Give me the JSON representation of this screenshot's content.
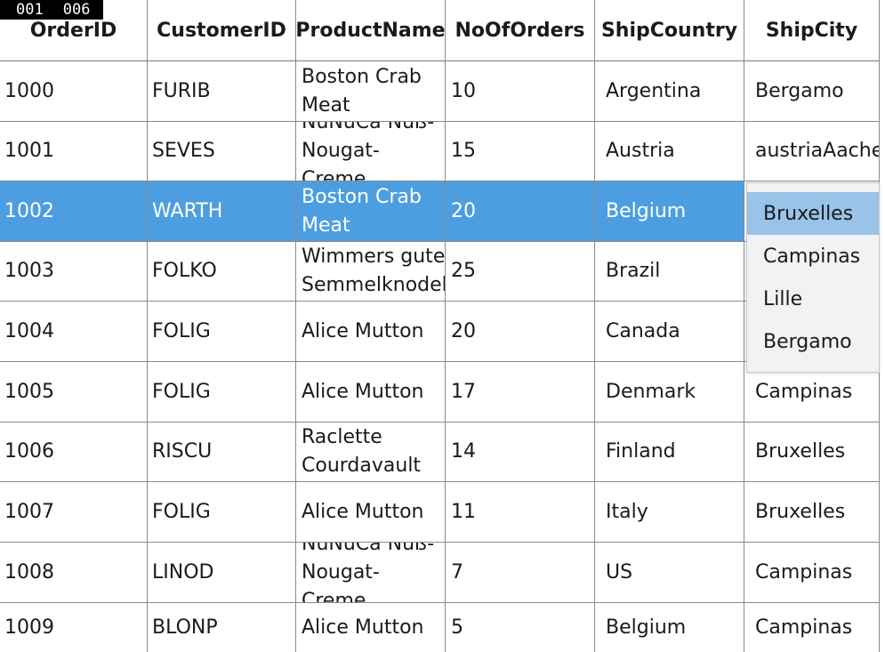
{
  "badge": {
    "left": "001",
    "right": "006"
  },
  "columns": [
    "OrderID",
    "CustomerID",
    "ProductName",
    "NoOfOrders",
    "ShipCountry",
    "ShipCity"
  ],
  "rows": [
    {
      "order": "1000",
      "customer": "FURIB",
      "product": "Boston Crab Meat",
      "orders": "10",
      "country": "Argentina",
      "city": "Bergamo"
    },
    {
      "order": "1001",
      "customer": "SEVES",
      "product": "NuNuCa Nuß-Nougat-Creme",
      "orders": "15",
      "country": "Austria",
      "city": "austriaAachen"
    },
    {
      "order": "1002",
      "customer": "WARTH",
      "product": "Boston Crab Meat",
      "orders": "20",
      "country": "Belgium",
      "city": ""
    },
    {
      "order": "1003",
      "customer": "FOLKO",
      "product": "Wimmers gute Semmelknodel",
      "orders": "25",
      "country": "Brazil",
      "city": ""
    },
    {
      "order": "1004",
      "customer": "FOLIG",
      "product": "Alice Mutton",
      "orders": "20",
      "country": "Canada",
      "city": ""
    },
    {
      "order": "1005",
      "customer": "FOLIG",
      "product": "Alice Mutton",
      "orders": "17",
      "country": "Denmark",
      "city": "Campinas"
    },
    {
      "order": "1006",
      "customer": "RISCU",
      "product": "Raclette Courdavault",
      "orders": "14",
      "country": "Finland",
      "city": "Bruxelles"
    },
    {
      "order": "1007",
      "customer": "FOLIG",
      "product": "Alice Mutton",
      "orders": "11",
      "country": "Italy",
      "city": "Bruxelles"
    },
    {
      "order": "1008",
      "customer": "LINOD",
      "product": "NuNuCa Nuß-Nougat-Creme",
      "orders": "7",
      "country": "US",
      "city": "Campinas"
    },
    {
      "order": "1009",
      "customer": "BLONP",
      "product": "Alice Mutton",
      "orders": "5",
      "country": "Belgium",
      "city": "Campinas"
    }
  ],
  "dropdown": {
    "options": [
      "Bruxelles",
      "Campinas",
      "Lille",
      "Bergamo"
    ],
    "selected": "Bruxelles"
  },
  "colors": {
    "selection": "#4c9ee0",
    "dropdown_selected": "#99c3e8",
    "dropdown_bg": "#f2f2f2"
  }
}
